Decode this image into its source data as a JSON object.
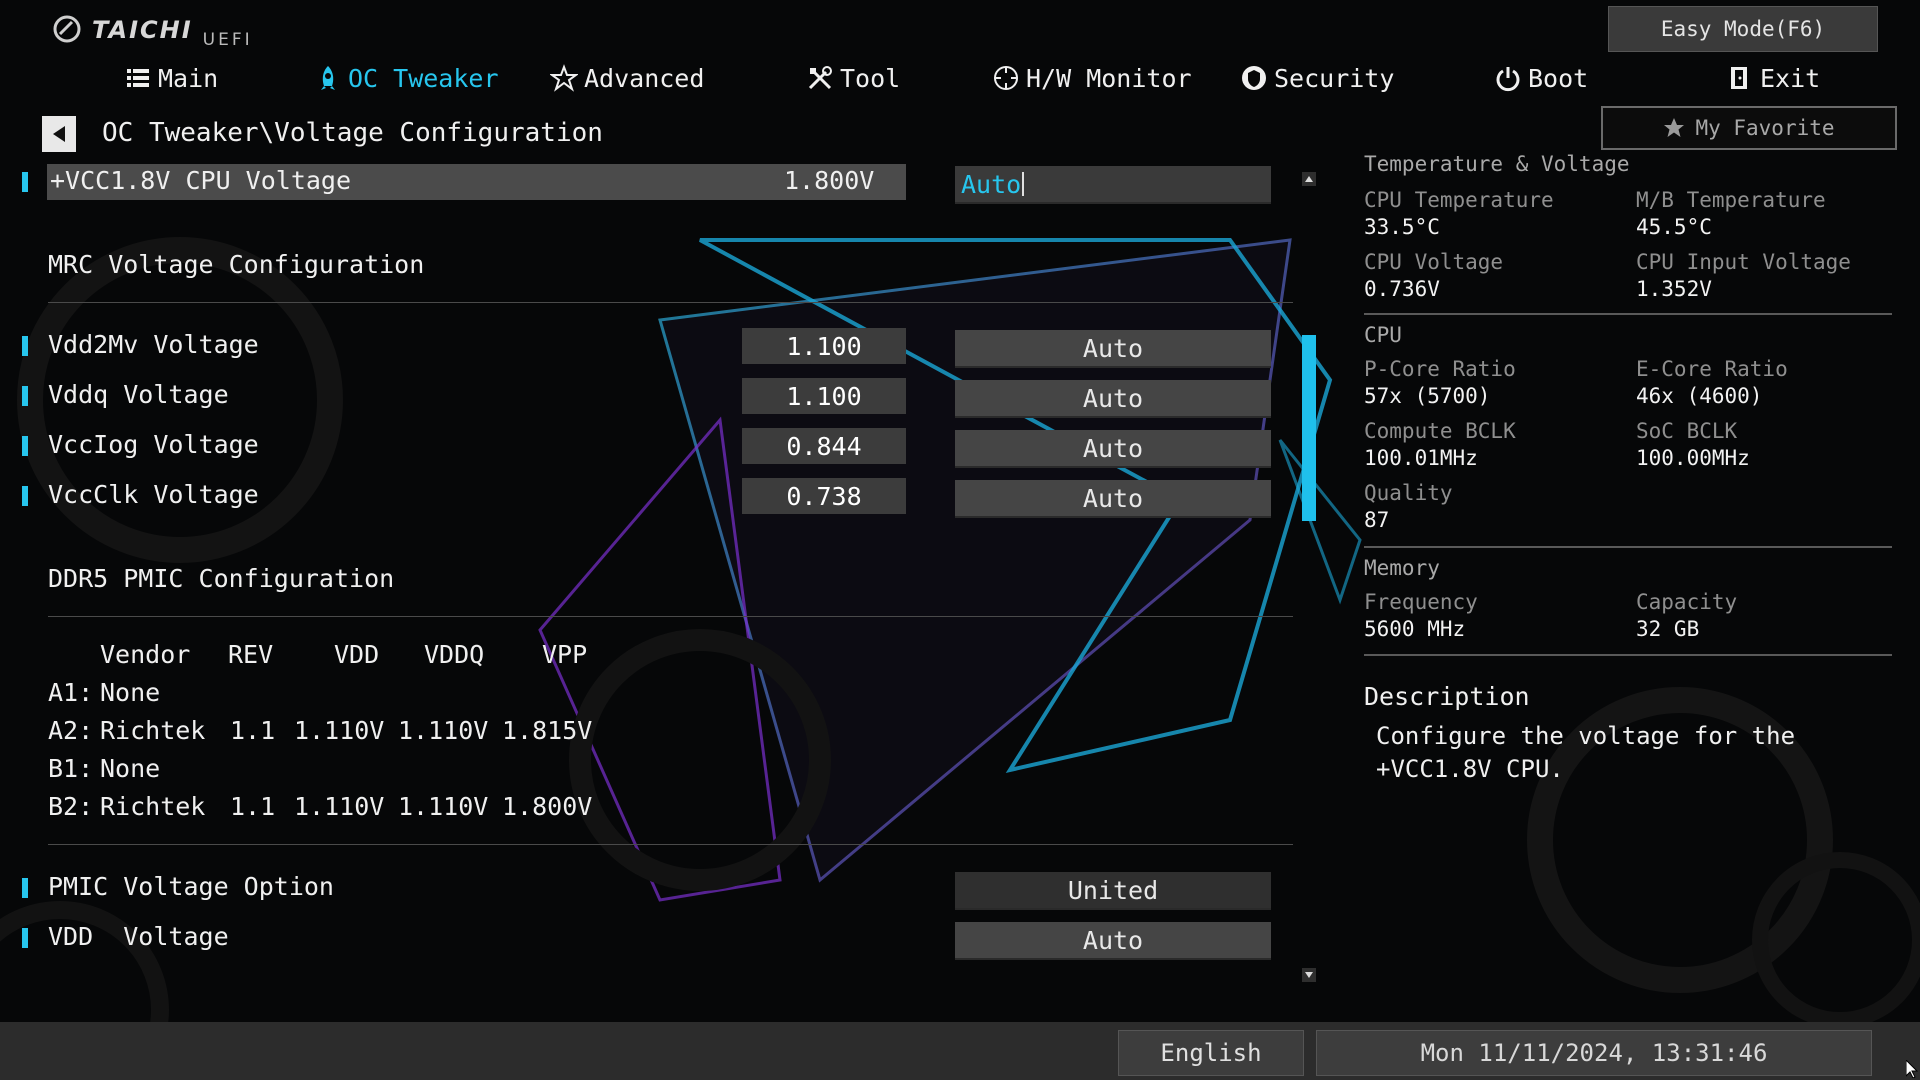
{
  "brand": {
    "name": "TAICHI",
    "sub": "UEFI"
  },
  "easy_mode": "Easy Mode(F6)",
  "nav": [
    {
      "label": "Main",
      "icon": "list-icon"
    },
    {
      "label": "OC Tweaker",
      "icon": "rocket-icon",
      "active": true
    },
    {
      "label": "Advanced",
      "icon": "star-icon"
    },
    {
      "label": "Tool",
      "icon": "tools-icon"
    },
    {
      "label": "H/W Monitor",
      "icon": "monitor-icon"
    },
    {
      "label": "Security",
      "icon": "shield-icon"
    },
    {
      "label": "Boot",
      "icon": "power-icon"
    },
    {
      "label": "Exit",
      "icon": "exit-icon"
    }
  ],
  "favorite": "My Favorite",
  "breadcrumb": "OC Tweaker\\Voltage Configuration",
  "vcc18": {
    "label": "+VCC1.8V CPU Voltage",
    "value": "1.800V",
    "setting": "Auto"
  },
  "mrc": {
    "title": "MRC Voltage Configuration",
    "rows": [
      {
        "label": "Vdd2Mv Voltage",
        "value": "1.100",
        "setting": "Auto"
      },
      {
        "label": "Vddq Voltage",
        "value": "1.100",
        "setting": "Auto"
      },
      {
        "label": "VccIog Voltage",
        "value": "0.844",
        "setting": "Auto"
      },
      {
        "label": "VccClk Voltage",
        "value": "0.738",
        "setting": "Auto"
      }
    ]
  },
  "pmic": {
    "title": "DDR5 PMIC Configuration",
    "headers": [
      "Vendor",
      "REV",
      "VDD",
      "VDDQ",
      "VPP"
    ],
    "rows": [
      {
        "slot": "A1:",
        "vendor": "None",
        "rev": "",
        "vdd": "",
        "vddq": "",
        "vpp": ""
      },
      {
        "slot": "A2:",
        "vendor": "Richtek",
        "rev": "1.1",
        "vdd": "1.110V",
        "vddq": "1.110V",
        "vpp": "1.815V"
      },
      {
        "slot": "B1:",
        "vendor": "None",
        "rev": "",
        "vdd": "",
        "vddq": "",
        "vpp": ""
      },
      {
        "slot": "B2:",
        "vendor": "Richtek",
        "rev": "1.1",
        "vdd": "1.110V",
        "vddq": "1.110V",
        "vpp": "1.800V"
      }
    ]
  },
  "pmic_option": {
    "label": "PMIC Voltage Option",
    "setting": "United"
  },
  "vdd_voltage": {
    "label": "VDD  Voltage",
    "setting": "Auto"
  },
  "panel": {
    "temp_title": "Temperature & Voltage",
    "cpu_temp_label": "CPU Temperature",
    "cpu_temp": "33.5°C",
    "mb_temp_label": "M/B Temperature",
    "mb_temp": "45.5°C",
    "cpu_volt_label": "CPU Voltage",
    "cpu_volt": "0.736V",
    "cpu_in_label": "CPU Input Voltage",
    "cpu_in": "1.352V",
    "cpu_title": "CPU",
    "pcore_label": "P-Core Ratio",
    "pcore": "57x (5700)",
    "ecore_label": "E-Core Ratio",
    "ecore": "46x (4600)",
    "bclk_label": "Compute BCLK",
    "bclk": "100.01MHz",
    "soc_label": "SoC BCLK",
    "soc": "100.00MHz",
    "quality_label": "Quality",
    "quality": "87",
    "mem_title": "Memory",
    "freq_label": "Frequency",
    "freq": "5600 MHz",
    "cap_label": "Capacity",
    "cap": "32 GB",
    "desc_title": "Description",
    "desc_text": "Configure the voltage for the +VCC1.8V CPU."
  },
  "scroll": {
    "position_fraction": 0.25
  },
  "language": "English",
  "datetime": "Mon 11/11/2024, 13:31:46",
  "colors": {
    "accent": "#27c6ee",
    "panel_bg": "#3c3c3c",
    "bg": "#060708"
  }
}
